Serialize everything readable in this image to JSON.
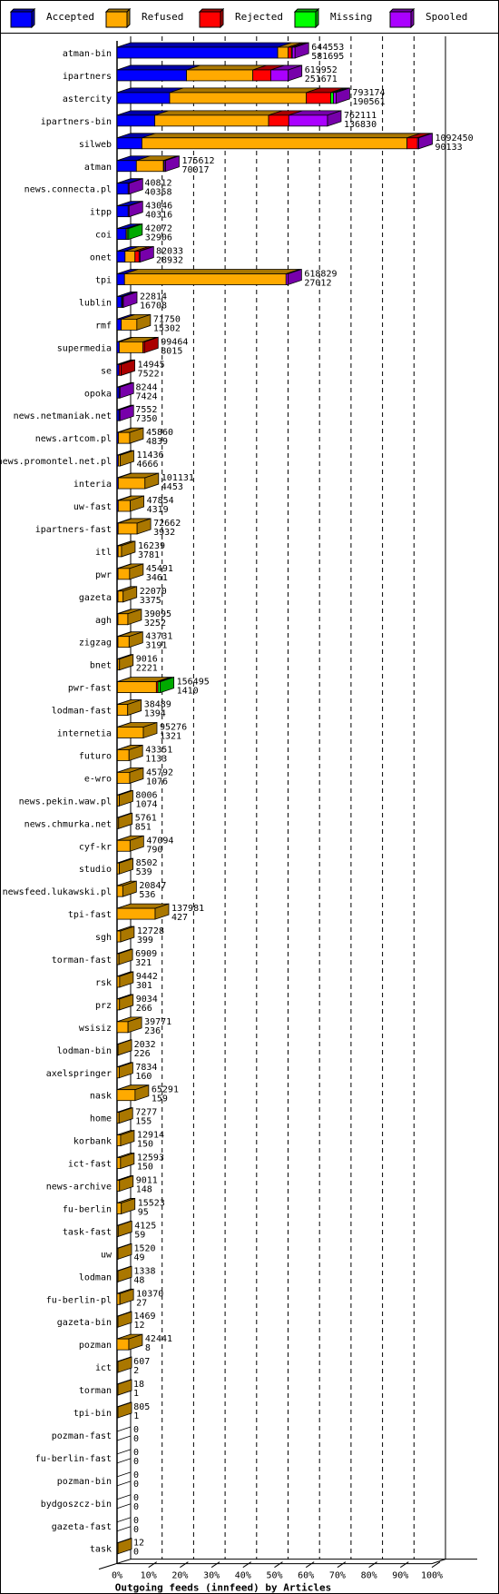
{
  "legend": [
    {
      "name": "Accepted",
      "color": "#0000ff",
      "side": "#0000aa"
    },
    {
      "name": "Refused",
      "color": "#ffaa00",
      "side": "#aa7700"
    },
    {
      "name": "Rejected",
      "color": "#ff0000",
      "side": "#aa0000"
    },
    {
      "name": "Missing",
      "color": "#00ff00",
      "side": "#00aa00"
    },
    {
      "name": "Spooled",
      "color": "#aa00ff",
      "side": "#7700aa"
    }
  ],
  "chart_data": {
    "type": "bar",
    "orientation": "horizontal",
    "stacked": true,
    "title": "Outgoing feeds (innfeed) by Articles",
    "xlabel": "Outgoing feeds (innfeed) by Articles",
    "xticks": [
      "0%",
      "10%",
      "20%",
      "30%",
      "40%",
      "50%",
      "60%",
      "70%",
      "80%",
      "90%",
      "100%"
    ],
    "grid": true,
    "legend_position": "top",
    "series_names": [
      "Accepted",
      "Refused",
      "Rejected",
      "Missing",
      "Spooled"
    ],
    "rows": [
      {
        "feed": "atman-bin",
        "label_top": "644553",
        "label_bottom": "581695",
        "segments": [
          581695,
          38000,
          12000,
          3000,
          9858
        ]
      },
      {
        "feed": "ipartners",
        "label_top": "619952",
        "label_bottom": "251671",
        "segments": [
          251671,
          240000,
          65000,
          0,
          63281
        ]
      },
      {
        "feed": "astercity",
        "label_top": "793174",
        "label_bottom": "190561",
        "segments": [
          190561,
          495000,
          88000,
          10000,
          9613
        ]
      },
      {
        "feed": "ipartners-bin",
        "label_top": "762111",
        "label_bottom": "136830",
        "segments": [
          136830,
          412000,
          73000,
          0,
          140281
        ]
      },
      {
        "feed": "silweb",
        "label_top": "1092450",
        "label_bottom": "90133",
        "segments": [
          90133,
          960000,
          38000,
          0,
          4317
        ]
      },
      {
        "feed": "atman",
        "label_top": "175612",
        "label_bottom": "70017",
        "segments": [
          70017,
          98000,
          0,
          3000,
          4595
        ]
      },
      {
        "feed": "news.connecta.pl",
        "label_top": "40812",
        "label_bottom": "40358",
        "segments": [
          40358,
          0,
          0,
          0,
          454
        ]
      },
      {
        "feed": "itpp",
        "label_top": "43046",
        "label_bottom": "40316",
        "segments": [
          40316,
          0,
          0,
          0,
          2730
        ]
      },
      {
        "feed": "coi",
        "label_top": "42072",
        "label_bottom": "32906",
        "segments": [
          32906,
          4000,
          0,
          5166,
          0
        ]
      },
      {
        "feed": "onet",
        "label_top": "82033",
        "label_bottom": "28932",
        "segments": [
          28932,
          36000,
          15000,
          0,
          2101
        ]
      },
      {
        "feed": "tpi",
        "label_top": "618829",
        "label_bottom": "27012",
        "segments": [
          27012,
          585000,
          0,
          0,
          6817
        ]
      },
      {
        "feed": "lublin",
        "label_top": "22814",
        "label_bottom": "16708",
        "segments": [
          16708,
          3000,
          0,
          0,
          3106
        ]
      },
      {
        "feed": "rmf",
        "label_top": "71750",
        "label_bottom": "15302",
        "segments": [
          15302,
          56448,
          0,
          0,
          0
        ]
      },
      {
        "feed": "supermedia",
        "label_top": "99464",
        "label_bottom": "8015",
        "segments": [
          8015,
          86000,
          5449,
          0,
          0
        ]
      },
      {
        "feed": "se",
        "label_top": "14945",
        "label_bottom": "7522",
        "segments": [
          7522,
          0,
          7423,
          0,
          0
        ]
      },
      {
        "feed": "opoka",
        "label_top": "8244",
        "label_bottom": "7424",
        "segments": [
          7424,
          0,
          0,
          0,
          820
        ]
      },
      {
        "feed": "news.netmaniak.net",
        "label_top": "7552",
        "label_bottom": "7350",
        "segments": [
          7350,
          0,
          0,
          0,
          202
        ]
      },
      {
        "feed": "news.artcom.pl",
        "label_top": "45860",
        "label_bottom": "4839",
        "segments": [
          4839,
          41021,
          0,
          0,
          0
        ]
      },
      {
        "feed": "news.promontel.net.pl",
        "label_top": "11436",
        "label_bottom": "4666",
        "segments": [
          4666,
          6770,
          0,
          0,
          0
        ]
      },
      {
        "feed": "interia",
        "label_top": "101131",
        "label_bottom": "4453",
        "segments": [
          4453,
          96678,
          0,
          0,
          0
        ]
      },
      {
        "feed": "uw-fast",
        "label_top": "47854",
        "label_bottom": "4319",
        "segments": [
          4319,
          43535,
          0,
          0,
          0
        ]
      },
      {
        "feed": "ipartners-fast",
        "label_top": "72662",
        "label_bottom": "3932",
        "segments": [
          3932,
          68730,
          0,
          0,
          0
        ]
      },
      {
        "feed": "itl",
        "label_top": "16239",
        "label_bottom": "3781",
        "segments": [
          3781,
          12458,
          0,
          0,
          0
        ]
      },
      {
        "feed": "pwr",
        "label_top": "45491",
        "label_bottom": "3461",
        "segments": [
          3461,
          42030,
          0,
          0,
          0
        ]
      },
      {
        "feed": "gazeta",
        "label_top": "22070",
        "label_bottom": "3375",
        "segments": [
          3375,
          18695,
          0,
          0,
          0
        ]
      },
      {
        "feed": "agh",
        "label_top": "39095",
        "label_bottom": "3252",
        "segments": [
          3252,
          35843,
          0,
          0,
          0
        ]
      },
      {
        "feed": "zigzag",
        "label_top": "43731",
        "label_bottom": "3191",
        "segments": [
          3191,
          40540,
          0,
          0,
          0
        ]
      },
      {
        "feed": "bnet",
        "label_top": "9016",
        "label_bottom": "2221",
        "segments": [
          2221,
          6795,
          0,
          0,
          0
        ]
      },
      {
        "feed": "pwr-fast",
        "label_top": "156495",
        "label_bottom": "1410",
        "segments": [
          1410,
          141000,
          6000,
          8085,
          0
        ]
      },
      {
        "feed": "lodman-fast",
        "label_top": "38489",
        "label_bottom": "1394",
        "segments": [
          1394,
          37095,
          0,
          0,
          0
        ]
      },
      {
        "feed": "internetia",
        "label_top": "95276",
        "label_bottom": "1321",
        "segments": [
          1321,
          93955,
          0,
          0,
          0
        ]
      },
      {
        "feed": "futuro",
        "label_top": "43351",
        "label_bottom": "1133",
        "segments": [
          1133,
          42218,
          0,
          0,
          0
        ]
      },
      {
        "feed": "e-wro",
        "label_top": "45792",
        "label_bottom": "1076",
        "segments": [
          1076,
          44716,
          0,
          0,
          0
        ]
      },
      {
        "feed": "news.pekin.waw.pl",
        "label_top": "8006",
        "label_bottom": "1074",
        "segments": [
          1074,
          6932,
          0,
          0,
          0
        ]
      },
      {
        "feed": "news.chmurka.net",
        "label_top": "5761",
        "label_bottom": "851",
        "segments": [
          851,
          4910,
          0,
          0,
          0
        ]
      },
      {
        "feed": "cyf-kr",
        "label_top": "47094",
        "label_bottom": "790",
        "segments": [
          790,
          46304,
          0,
          0,
          0
        ]
      },
      {
        "feed": "studio",
        "label_top": "8502",
        "label_bottom": "539",
        "segments": [
          539,
          7963,
          0,
          0,
          0
        ]
      },
      {
        "feed": "newsfeed.lukawski.pl",
        "label_top": "20847",
        "label_bottom": "536",
        "segments": [
          536,
          20311,
          0,
          0,
          0
        ]
      },
      {
        "feed": "tpi-fast",
        "label_top": "137981",
        "label_bottom": "427",
        "segments": [
          427,
          137554,
          0,
          0,
          0
        ]
      },
      {
        "feed": "sgh",
        "label_top": "12728",
        "label_bottom": "399",
        "segments": [
          399,
          12329,
          0,
          0,
          0
        ]
      },
      {
        "feed": "torman-fast",
        "label_top": "6909",
        "label_bottom": "321",
        "segments": [
          321,
          6588,
          0,
          0,
          0
        ]
      },
      {
        "feed": "rsk",
        "label_top": "9442",
        "label_bottom": "301",
        "segments": [
          301,
          9141,
          0,
          0,
          0
        ]
      },
      {
        "feed": "prz",
        "label_top": "9034",
        "label_bottom": "266",
        "segments": [
          266,
          8768,
          0,
          0,
          0
        ]
      },
      {
        "feed": "wsisiz",
        "label_top": "39771",
        "label_bottom": "236",
        "segments": [
          236,
          39535,
          0,
          0,
          0
        ]
      },
      {
        "feed": "lodman-bin",
        "label_top": "2032",
        "label_bottom": "226",
        "segments": [
          226,
          1806,
          0,
          0,
          0
        ]
      },
      {
        "feed": "axelspringer",
        "label_top": "7834",
        "label_bottom": "160",
        "segments": [
          160,
          7674,
          0,
          0,
          0
        ]
      },
      {
        "feed": "nask",
        "label_top": "65291",
        "label_bottom": "159",
        "segments": [
          159,
          65132,
          0,
          0,
          0
        ]
      },
      {
        "feed": "home",
        "label_top": "7277",
        "label_bottom": "155",
        "segments": [
          155,
          7122,
          0,
          0,
          0
        ]
      },
      {
        "feed": "korbank",
        "label_top": "12914",
        "label_bottom": "150",
        "segments": [
          150,
          12764,
          0,
          0,
          0
        ]
      },
      {
        "feed": "ict-fast",
        "label_top": "12593",
        "label_bottom": "150",
        "segments": [
          150,
          12443,
          0,
          0,
          0
        ]
      },
      {
        "feed": "news-archive",
        "label_top": "9011",
        "label_bottom": "148",
        "segments": [
          148,
          8863,
          0,
          0,
          0
        ]
      },
      {
        "feed": "fu-berlin",
        "label_top": "15523",
        "label_bottom": "95",
        "segments": [
          95,
          15428,
          0,
          0,
          0
        ]
      },
      {
        "feed": "task-fast",
        "label_top": "4125",
        "label_bottom": "59",
        "segments": [
          59,
          4066,
          0,
          0,
          0
        ]
      },
      {
        "feed": "uw",
        "label_top": "1520",
        "label_bottom": "49",
        "segments": [
          49,
          1471,
          0,
          0,
          0
        ]
      },
      {
        "feed": "lodman",
        "label_top": "1338",
        "label_bottom": "48",
        "segments": [
          48,
          1290,
          0,
          0,
          0
        ]
      },
      {
        "feed": "fu-berlin-pl",
        "label_top": "10370",
        "label_bottom": "27",
        "segments": [
          27,
          10343,
          0,
          0,
          0
        ]
      },
      {
        "feed": "gazeta-bin",
        "label_top": "1469",
        "label_bottom": "12",
        "segments": [
          12,
          1457,
          0,
          0,
          0
        ]
      },
      {
        "feed": "pozman",
        "label_top": "42441",
        "label_bottom": "8",
        "segments": [
          8,
          42433,
          0,
          0,
          0
        ]
      },
      {
        "feed": "ict",
        "label_top": "607",
        "label_bottom": "2",
        "segments": [
          2,
          605,
          0,
          0,
          0
        ]
      },
      {
        "feed": "torman",
        "label_top": "18",
        "label_bottom": "1",
        "segments": [
          1,
          17,
          0,
          0,
          0
        ]
      },
      {
        "feed": "tpi-bin",
        "label_top": "805",
        "label_bottom": "1",
        "segments": [
          1,
          804,
          0,
          0,
          0
        ]
      },
      {
        "feed": "pozman-fast",
        "label_top": "0",
        "label_bottom": "0",
        "segments": [
          0,
          0,
          0,
          0,
          0
        ]
      },
      {
        "feed": "fu-berlin-fast",
        "label_top": "0",
        "label_bottom": "0",
        "segments": [
          0,
          0,
          0,
          0,
          0
        ]
      },
      {
        "feed": "pozman-bin",
        "label_top": "0",
        "label_bottom": "0",
        "segments": [
          0,
          0,
          0,
          0,
          0
        ]
      },
      {
        "feed": "bydgoszcz-bin",
        "label_top": "0",
        "label_bottom": "0",
        "segments": [
          0,
          0,
          0,
          0,
          0
        ]
      },
      {
        "feed": "gazeta-fast",
        "label_top": "0",
        "label_bottom": "0",
        "segments": [
          0,
          0,
          0,
          0,
          0
        ]
      },
      {
        "feed": "task",
        "label_top": "12",
        "label_bottom": "0",
        "segments": [
          0,
          12,
          0,
          0,
          0
        ]
      }
    ]
  }
}
